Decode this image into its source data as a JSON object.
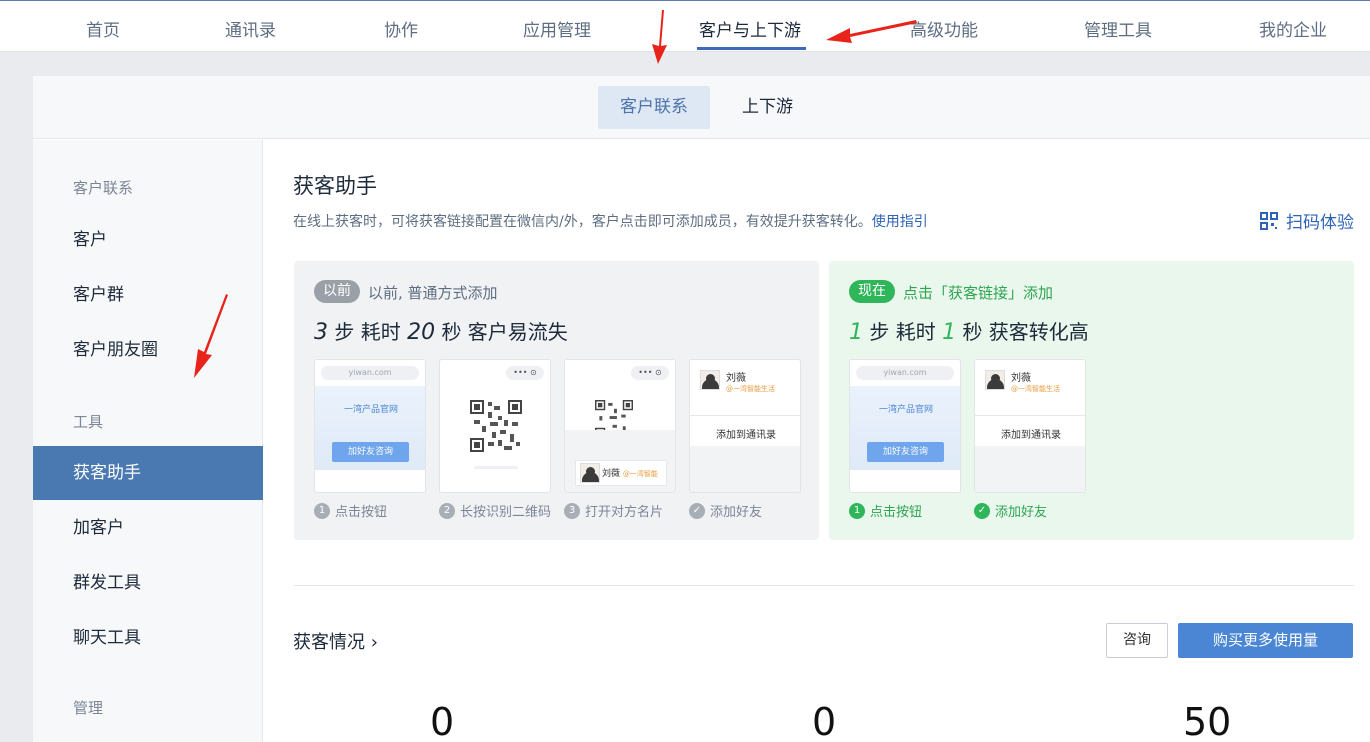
{
  "topnav": {
    "items": [
      "首页",
      "通讯录",
      "协作",
      "应用管理",
      "客户与上下游",
      "高级功能",
      "管理工具",
      "我的企业"
    ]
  },
  "subtabs": [
    "客户联系",
    "上下游"
  ],
  "sidebar": {
    "section1": "客户联系",
    "items1": [
      "客户",
      "客户群",
      "客户朋友圈"
    ],
    "section2": "工具",
    "items2": [
      "获客助手",
      "加客户",
      "群发工具",
      "聊天工具"
    ],
    "section3": "管理"
  },
  "main": {
    "title": "获客助手",
    "desc": "在线上获客时，可将获客链接配置在微信内/外，客户点击即可添加成员，有效提升获客转化。",
    "guide_link": "使用指引",
    "scan_label": "扫码体验",
    "before": {
      "badge": "以前",
      "badge_text": "以前, 普通方式添加",
      "steps_count": "3",
      "steps_word": "步 耗时",
      "time_count": "20",
      "time_word": "秒 客户易流失",
      "steps": [
        "点击按钮",
        "长按识别二维码",
        "打开对方名片",
        "添加好友"
      ]
    },
    "after": {
      "badge": "现在",
      "badge_text": "点击「获客链接」添加",
      "steps_count": "1",
      "steps_word": "步 耗时",
      "time_count": "1",
      "time_word": "秒 获客转化高",
      "steps": [
        "点击按钮",
        "添加好友"
      ]
    },
    "mock": {
      "url": "yiwan.com",
      "hero_title": "一湾产品官网",
      "hero_button": "加好友咨询",
      "dots": "••• ⊙",
      "contact_name": "刘薇",
      "contact_org": "@一湾智能",
      "card_org": "@一湾智能生活",
      "add_to_contacts": "添加到通讯录"
    },
    "stats_title": "获客情况 ›",
    "consult_button": "咨询",
    "buy_button": "购买更多使用量",
    "stats": [
      "0",
      "0",
      "50"
    ]
  },
  "colors": {
    "accent": "#4a78b0",
    "link": "#2f63b5",
    "green": "#2fb55a",
    "annotation_arrow": "#e8231a"
  }
}
